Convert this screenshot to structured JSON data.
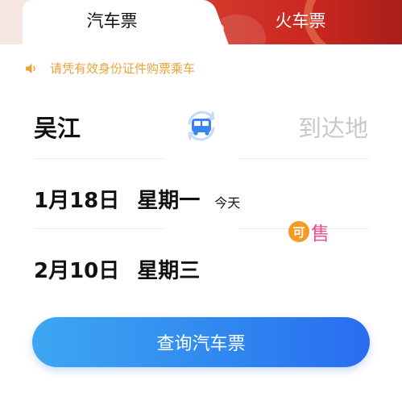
{
  "tabs": {
    "bus": "汽车票",
    "train": "火车票"
  },
  "notice": {
    "text": "请凭有效身份证件购票乘车"
  },
  "route": {
    "from": "吴江",
    "to_placeholder": "到达地"
  },
  "dates": [
    {
      "date": "1月18日",
      "weekday": "星期一",
      "tag": "今天"
    },
    {
      "date": "2月10日",
      "weekday": "星期三",
      "tag": ""
    }
  ],
  "sell_badge": {
    "badge": "可",
    "text": "售"
  },
  "query_button": "查询汽车票",
  "colors": {
    "notice": "#e8a33d",
    "train_tab": "#d33a2c",
    "button": "#2f86f0",
    "sell_badge": "#f59a23",
    "sell_text": "#ea4d93"
  }
}
